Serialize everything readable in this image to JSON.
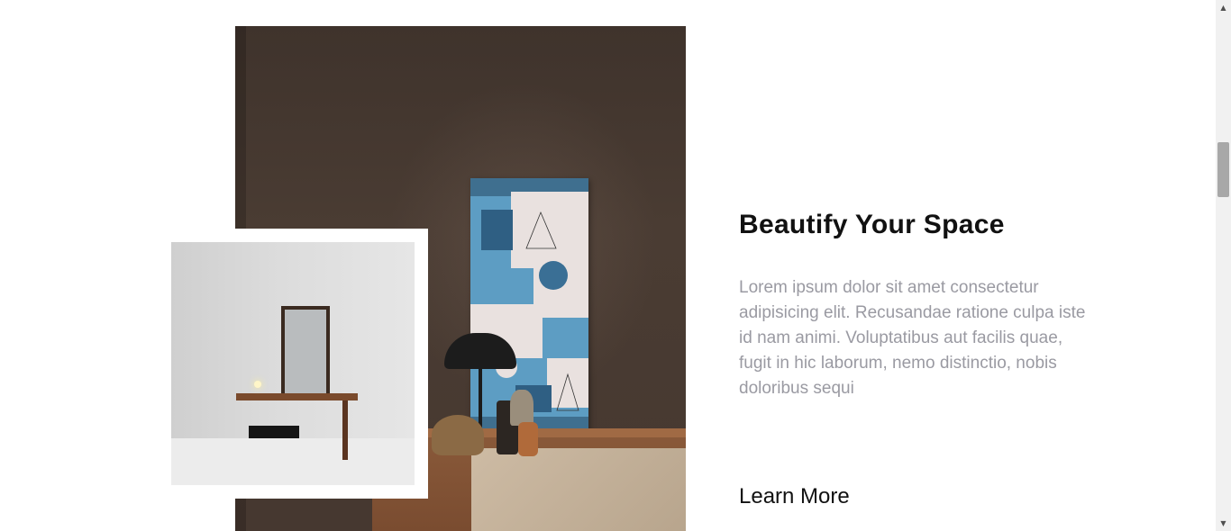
{
  "feature": {
    "heading": "Beautify Your Space",
    "body": "Lorem ipsum dolor sit amet consectetur adipisicing elit. Recusandae ratione culpa iste id nam animi. Voluptatibus aut facilis quae, fugit in hic laborum, nemo distinctio, nobis doloribus sequi",
    "cta_label": "Learn More"
  },
  "scrollbar": {
    "up_icon": "▲",
    "down_icon": "▼"
  },
  "colors": {
    "heading": "#111111",
    "body_text": "#9a9aa2",
    "photo_wall": "#463830",
    "artwork_blue": "#5fa0c6"
  },
  "icons": [
    "scroll-up-arrow-icon",
    "scroll-down-arrow-icon"
  ]
}
